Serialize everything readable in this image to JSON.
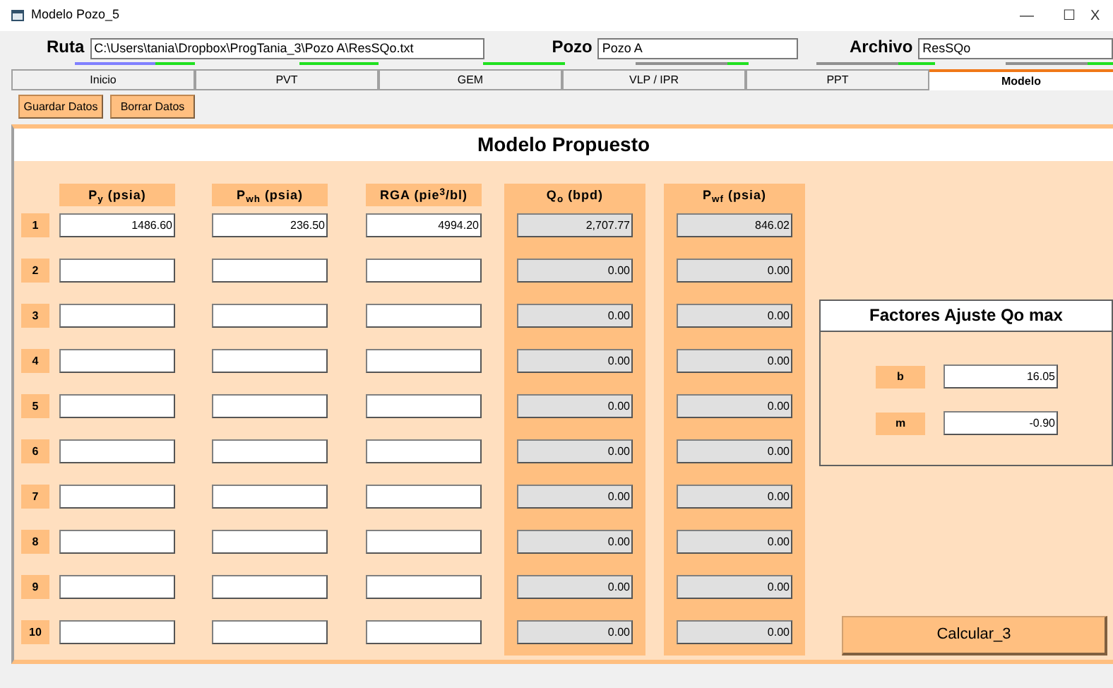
{
  "window": {
    "title": "Modelo Pozo_5",
    "controls": [
      "—",
      "☐",
      "X"
    ]
  },
  "header_fields": [
    {
      "label": "Ruta",
      "value": "C:\\Users\\tania\\Dropbox\\ProgTania_3\\Pozo A\\ResSQo.txt"
    },
    {
      "label": "Pozo",
      "value": "Pozo A"
    },
    {
      "label": "Archivo",
      "value": "ResSQo"
    }
  ],
  "tabs": [
    {
      "label": "Inicio",
      "selected": false
    },
    {
      "label": "PVT",
      "selected": false
    },
    {
      "label": "GEM",
      "selected": false
    },
    {
      "label": "VLP / IPR",
      "selected": false
    },
    {
      "label": "PPT",
      "selected": false
    },
    {
      "label": "Modelo",
      "selected": true
    }
  ],
  "toolbar": [
    "Guardar Datos",
    "Borrar Datos"
  ],
  "panel_title": "Modelo Propuesto",
  "columns": [
    {
      "label": "P$_{y}$ (psia)",
      "kind": "input"
    },
    {
      "label": "P$_{wh}$ (psia)",
      "kind": "input"
    },
    {
      "label": "RGA (pie$^{3}$/bl)",
      "kind": "input"
    },
    {
      "label": "Q$_{o}$ (bpd)",
      "kind": "output"
    },
    {
      "label": "P$_{wf}$ (psia)",
      "kind": "output"
    }
  ],
  "rows": [
    {
      "number": "1",
      "inputs": [
        "1486.60",
        "236.50",
        "4994.20"
      ],
      "outputs": [
        "2,707.77",
        "846.02"
      ]
    },
    {
      "number": "2",
      "outputs": [
        "0.00",
        "0.00"
      ]
    },
    {
      "number": "3",
      "outputs": [
        "0.00",
        "0.00"
      ]
    },
    {
      "number": "4",
      "outputs": [
        "0.00",
        "0.00"
      ]
    },
    {
      "number": "5",
      "outputs": [
        "0.00",
        "0.00"
      ]
    },
    {
      "number": "6",
      "outputs": [
        "0.00",
        "0.00"
      ]
    },
    {
      "number": "7",
      "outputs": [
        "0.00",
        "0.00"
      ]
    },
    {
      "number": "8",
      "outputs": [
        "0.00",
        "0.00"
      ]
    },
    {
      "number": "9",
      "outputs": [
        "0.00",
        "0.00"
      ]
    },
    {
      "number": "10",
      "outputs": [
        "0.00",
        "0.00"
      ]
    }
  ],
  "factors": {
    "title": "Factores Ajuste Qo max",
    "items": [
      {
        "label": "b",
        "value": "16.05"
      },
      {
        "label": "m",
        "value": "-0.90"
      }
    ]
  },
  "calculate_button": "Calcular_3"
}
